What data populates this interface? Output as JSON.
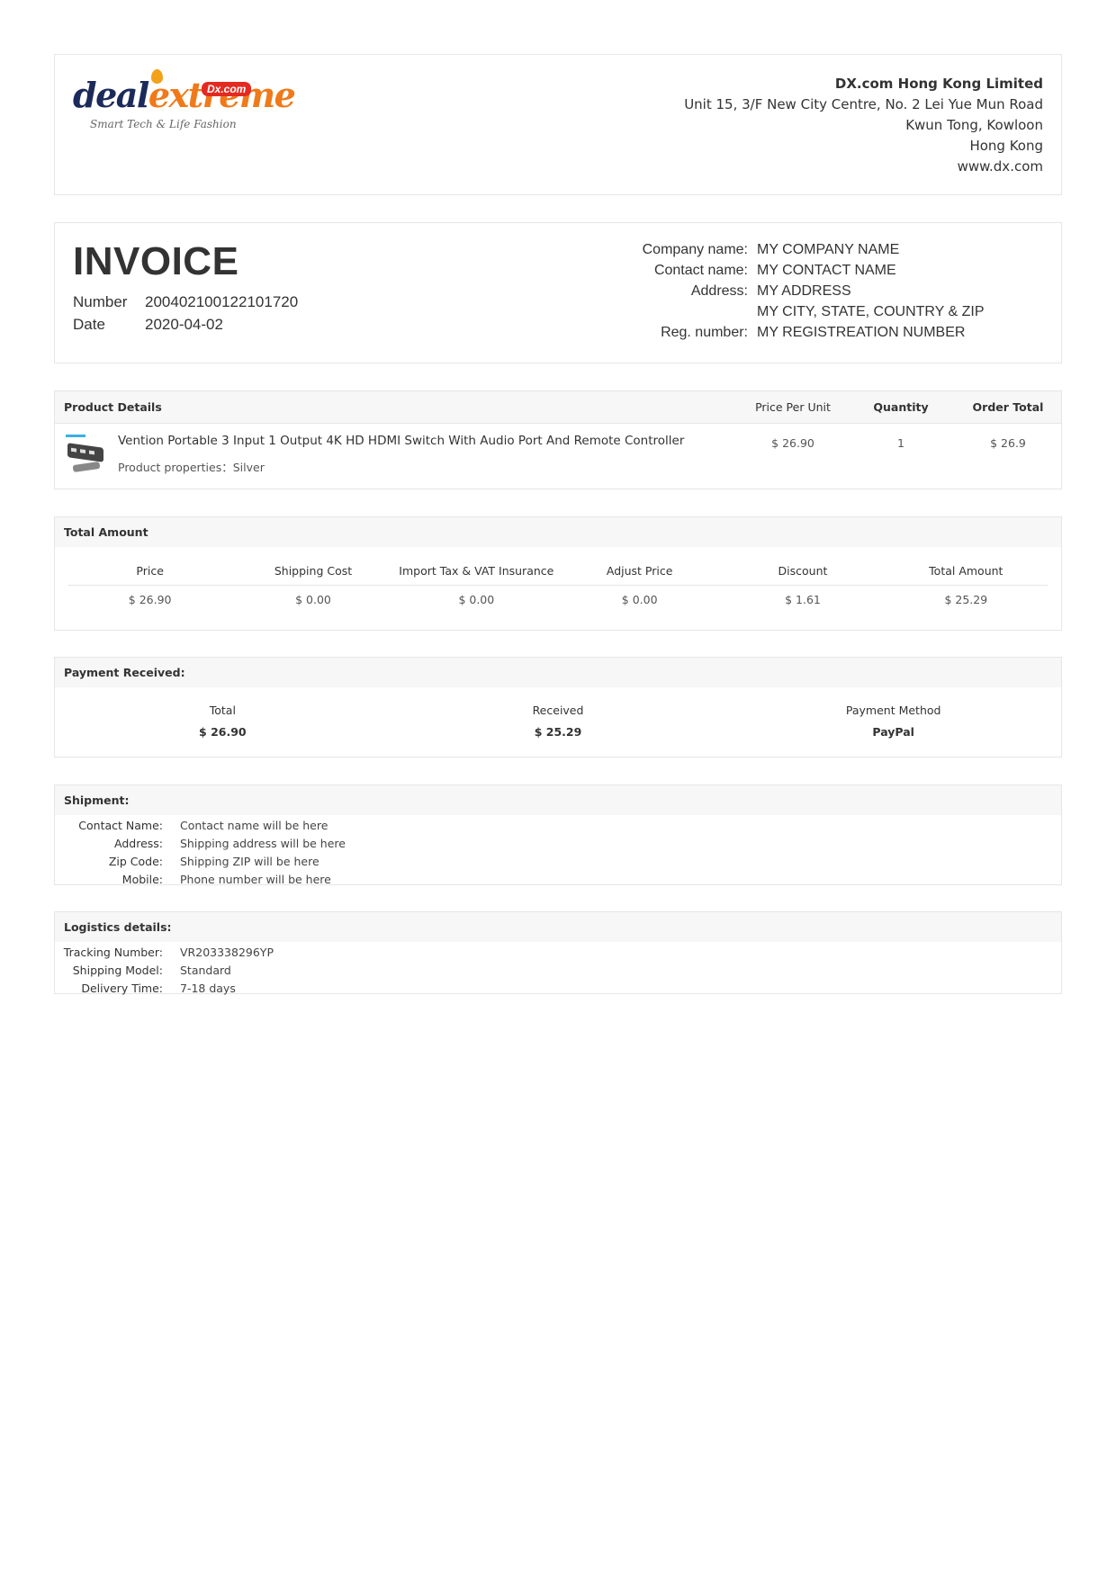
{
  "logo": {
    "brand_a": "deal",
    "brand_b": "extreme",
    "badge": "Dx.com",
    "tagline": "Smart Tech & Life Fashion"
  },
  "company": {
    "name": "DX.com Hong Kong Limited",
    "line1": "Unit 15, 3/F New City Centre, No. 2 Lei Yue Mun Road",
    "line2": "Kwun Tong, Kowloon",
    "line3": "Hong Kong",
    "website": "www.dx.com"
  },
  "invoice": {
    "title": "INVOICE",
    "number_label": "Number",
    "number": "200402100122101720",
    "date_label": "Date",
    "date": "2020-04-02"
  },
  "billing": [
    {
      "label": "Company name:",
      "value": "MY COMPANY NAME"
    },
    {
      "label": "Contact name:",
      "value": "MY CONTACT NAME"
    },
    {
      "label": "Address:",
      "value": "MY ADDRESS"
    },
    {
      "label": "",
      "value": "MY CITY, STATE, COUNTRY & ZIP"
    },
    {
      "label": "Reg. number:",
      "value": "MY REGISTREATION NUMBER"
    }
  ],
  "product": {
    "head": {
      "details": "Product Details",
      "ppu": "Price Per Unit",
      "qty": "Quantity",
      "total": "Order Total"
    },
    "name": "Vention Portable 3 Input 1 Output 4K HD HDMI Switch With Audio Port And Remote Controller",
    "props": "Product properties：Silver",
    "ppu": "$ 26.90",
    "qty": "1",
    "total": "$ 26.9"
  },
  "total_amount": {
    "title": "Total Amount",
    "headers": [
      "Price",
      "Shipping Cost",
      "Import Tax & VAT Insurance",
      "Adjust Price",
      "Discount",
      "Total Amount"
    ],
    "values": [
      "$ 26.90",
      "$ 0.00",
      "$ 0.00",
      "$ 0.00",
      "$ 1.61",
      "$ 25.29"
    ]
  },
  "payment": {
    "title": "Payment Received:",
    "headers": [
      "Total",
      "Received",
      "Payment Method"
    ],
    "values": [
      "$ 26.90",
      "$ 25.29",
      "PayPal"
    ]
  },
  "shipment": {
    "title": "Shipment:",
    "rows": [
      {
        "label": "Contact Name:",
        "value": "Contact name will be here"
      },
      {
        "label": "Address:",
        "value": "Shipping address will be here"
      },
      {
        "label": "Zip Code:",
        "value": "Shipping ZIP will be here"
      },
      {
        "label": "Mobile:",
        "value": "Phone number will be here"
      }
    ]
  },
  "logistics": {
    "title": "Logistics details:",
    "rows": [
      {
        "label": "Tracking Number:",
        "value": "VR203338296YP"
      },
      {
        "label": "Shipping Model:",
        "value": "Standard"
      },
      {
        "label": "Delivery Time:",
        "value": "7-18 days"
      }
    ]
  }
}
